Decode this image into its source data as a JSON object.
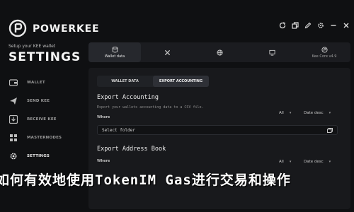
{
  "app": {
    "brand": "POWERKEE",
    "subtitle": "Setup your KEE wallet",
    "section_title": "SETTINGS"
  },
  "sidebar": {
    "items": [
      {
        "label": "WALLET",
        "icon": "wallet-icon"
      },
      {
        "label": "SEND KEE",
        "icon": "send-icon"
      },
      {
        "label": "RECEIVE KEE",
        "icon": "receive-icon"
      },
      {
        "label": "MASTERNODES",
        "icon": "masternodes-icon"
      },
      {
        "label": "SETTINGS",
        "icon": "gear-icon"
      }
    ]
  },
  "window_controls": [
    "refresh-icon",
    "copy-icon",
    "pen-icon",
    "settings-icon",
    "minimize-icon",
    "close-icon"
  ],
  "toolbar": {
    "items": [
      {
        "label": "Wallet data",
        "icon": "database-icon"
      },
      {
        "label": "",
        "icon": "tools-icon"
      },
      {
        "label": "",
        "icon": "globe-icon"
      },
      {
        "label": "",
        "icon": "display-icon"
      },
      {
        "label": "Kee Core v4.9",
        "icon": "kee-core-icon"
      }
    ]
  },
  "tabs": [
    "WALLET DATA",
    "EXPORT ACCOUNTING"
  ],
  "export_accounting": {
    "title": "Export Accounting",
    "description": "Export your wallets accounting data to a CSV file.",
    "where_label": "Where",
    "filter_all": "All",
    "filter_date": "Date desc",
    "folder_placeholder": "Select folder"
  },
  "export_address_book": {
    "title": "Export Address Book",
    "where_label": "Where",
    "filter_all": "All",
    "filter_date": "Date desc"
  },
  "overlay_headline": "如何有效地使用TokenIM Gas进行交易和操作"
}
